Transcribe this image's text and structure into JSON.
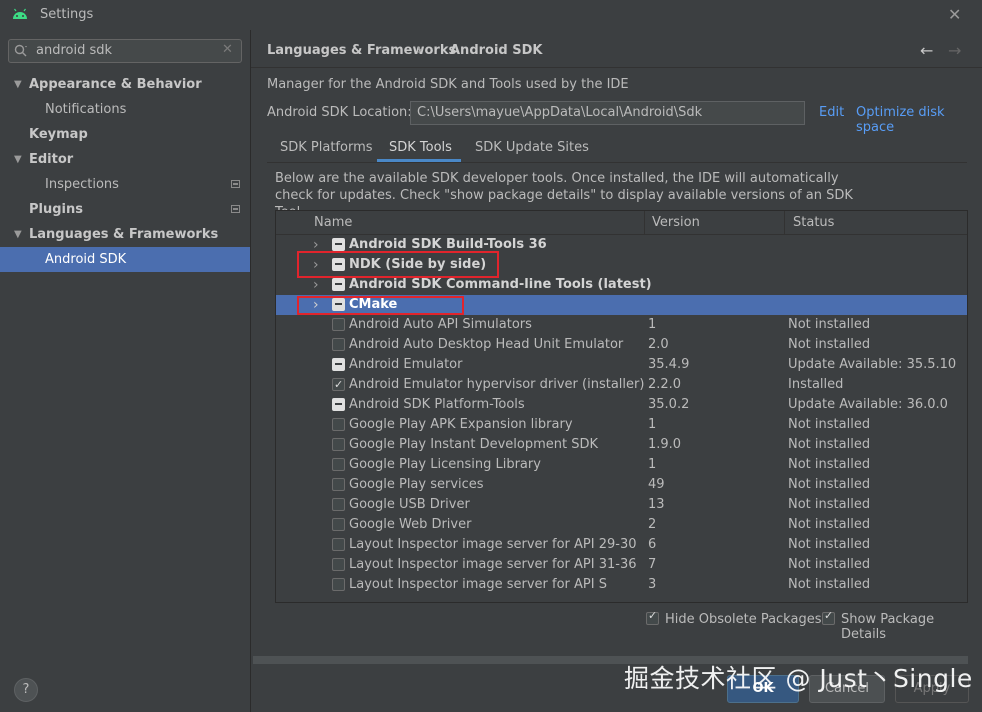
{
  "window": {
    "title": "Settings",
    "close_icon": "close-icon"
  },
  "search": {
    "value": "android sdk"
  },
  "sidebar": {
    "items": [
      {
        "label": "Appearance & Behavior",
        "expanded": true
      },
      {
        "label": "Notifications"
      },
      {
        "label": "Keymap"
      },
      {
        "label": "Editor",
        "expanded": true
      },
      {
        "label": "Inspections"
      },
      {
        "label": "Plugins"
      },
      {
        "label": "Languages & Frameworks",
        "expanded": true
      },
      {
        "label": "Android SDK",
        "selected": true
      }
    ]
  },
  "header": {
    "breadcrumb": [
      "Languages & Frameworks",
      "Android SDK"
    ],
    "separator": "›"
  },
  "main": {
    "description": "Manager for the Android SDK and Tools used by the IDE",
    "location_label": "Android SDK Location:",
    "location_value": "C:\\Users\\mayue\\AppData\\Local\\Android\\Sdk",
    "edit_link": "Edit",
    "optimize_link": "Optimize disk space",
    "tabs": [
      {
        "label": "SDK Platforms"
      },
      {
        "label": "SDK Tools",
        "active": true
      },
      {
        "label": "SDK Update Sites"
      }
    ],
    "tools_description": "Below are the available SDK developer tools. Once installed, the IDE will automatically check for updates. Check \"show package details\" to display available versions of an SDK Tool."
  },
  "table": {
    "columns": [
      "Name",
      "Version",
      "Status"
    ],
    "rows": [
      {
        "name": "Android SDK Build-Tools 36",
        "version": "",
        "status": "",
        "group": true,
        "state": "partial"
      },
      {
        "name": "NDK (Side by side)",
        "version": "",
        "status": "",
        "group": true,
        "state": "partial"
      },
      {
        "name": "Android SDK Command-line Tools (latest)",
        "version": "",
        "status": "",
        "group": true,
        "state": "partial"
      },
      {
        "name": "CMake",
        "version": "",
        "status": "",
        "group": true,
        "state": "partial",
        "selected": true
      },
      {
        "name": "Android Auto API Simulators",
        "version": "1",
        "status": "Not installed",
        "state": "unchecked"
      },
      {
        "name": "Android Auto Desktop Head Unit Emulator",
        "version": "2.0",
        "status": "Not installed",
        "state": "unchecked"
      },
      {
        "name": "Android Emulator",
        "version": "35.4.9",
        "status": "Update Available: 35.5.10",
        "state": "partial"
      },
      {
        "name": "Android Emulator hypervisor driver (installer)",
        "version": "2.2.0",
        "status": "Installed",
        "state": "checked"
      },
      {
        "name": "Android SDK Platform-Tools",
        "version": "35.0.2",
        "status": "Update Available: 36.0.0",
        "state": "partial"
      },
      {
        "name": "Google Play APK Expansion library",
        "version": "1",
        "status": "Not installed",
        "state": "unchecked"
      },
      {
        "name": "Google Play Instant Development SDK",
        "version": "1.9.0",
        "status": "Not installed",
        "state": "unchecked"
      },
      {
        "name": "Google Play Licensing Library",
        "version": "1",
        "status": "Not installed",
        "state": "unchecked"
      },
      {
        "name": "Google Play services",
        "version": "49",
        "status": "Not installed",
        "state": "unchecked"
      },
      {
        "name": "Google USB Driver",
        "version": "13",
        "status": "Not installed",
        "state": "unchecked"
      },
      {
        "name": "Google Web Driver",
        "version": "2",
        "status": "Not installed",
        "state": "unchecked"
      },
      {
        "name": "Layout Inspector image server for API 29-30",
        "version": "6",
        "status": "Not installed",
        "state": "unchecked"
      },
      {
        "name": "Layout Inspector image server for API 31-36",
        "version": "7",
        "status": "Not installed",
        "state": "unchecked"
      },
      {
        "name": "Layout Inspector image server for API S",
        "version": "3",
        "status": "Not installed",
        "state": "unchecked"
      }
    ]
  },
  "options": {
    "hide_obsolete": "Hide Obsolete Packages",
    "show_details": "Show Package Details"
  },
  "footer": {
    "help": "?",
    "ok": "OK",
    "cancel": "Cancel",
    "apply": "Apply",
    "watermark": "掘金技术社区 @ Just丶Single"
  },
  "colors": {
    "background": "#3c3f41",
    "selection": "#4b6eaf",
    "link": "#589df6",
    "highlight_box": "#e1242c",
    "android_green": "#3ddc84"
  }
}
